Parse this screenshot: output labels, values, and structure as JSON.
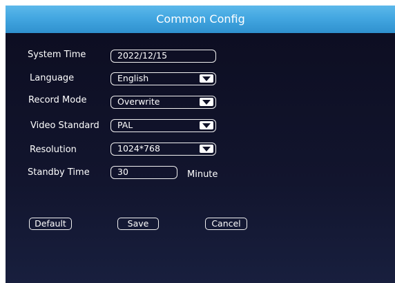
{
  "window": {
    "title": "Common Config"
  },
  "form": {
    "system_time": {
      "label": "System Time",
      "value": "2022/12/15"
    },
    "language": {
      "label": "Language",
      "value": "English"
    },
    "record_mode": {
      "label": "Record Mode",
      "value": "Overwrite"
    },
    "video_standard": {
      "label": "Video Standard",
      "value": "PAL"
    },
    "resolution": {
      "label": "Resolution",
      "value": "1024*768"
    },
    "standby_time": {
      "label": "Standby Time",
      "value": "30",
      "unit": "Minute"
    }
  },
  "buttons": {
    "default": "Default",
    "save": "Save",
    "cancel": "Cancel"
  },
  "colors": {
    "titlebar": "#43a7e1",
    "panel": "#12152e",
    "text": "#ffffff"
  }
}
